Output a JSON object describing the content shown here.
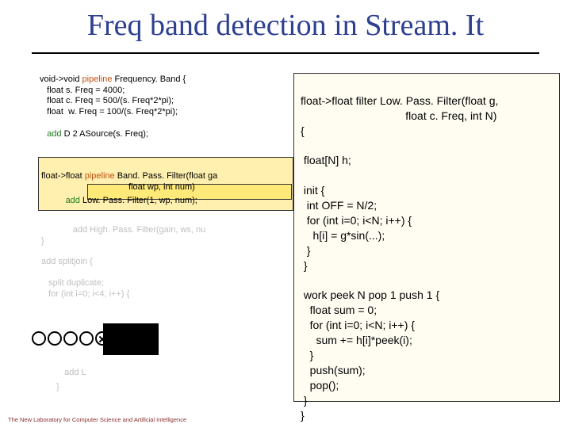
{
  "title": "Freq band detection in Stream. It",
  "footer": "The New Laboratory for Computer Science and Artificial Intelligence",
  "left": {
    "sig0": "void->void ",
    "kw_pipeline0": "pipeline",
    "sig0b": " Frequency. Band {",
    "l1": "   float s. Freq = 4000;",
    "l2": "   float c. Freq = 500/(s. Freq*2*pi);",
    "l3": "   float  w. Freq = 100/(s. Freq*2*pi);",
    "add1_pre": "   ",
    "add1_kw": "add",
    "add1_post": " D 2 ASource(s. Freq);",
    "sig1": "float->float ",
    "kw_pipeline1": "pipeline",
    "sig1b": " Band. Pass. Filter(float ga",
    "sig1c": "                                    float wp, int num)",
    "add2_pre": "          ",
    "add2_kw": "add",
    "add2_post": " Low. Pass. Filter(1, wp, num);",
    "hp_pre": "             ",
    "hp": "add High. Pass. Filter(gain, ws, nu",
    "cb1": "}",
    "sj": "add splitjoin {",
    "sj_split": "   split duplicate;",
    "sj_for": "   for (int i=0; i<4; i++) {",
    "addL": "   add L",
    "cb2": "   }",
    "circles": [
      "open",
      "open",
      "open",
      "open",
      "x",
      "x",
      "x",
      "x"
    ]
  },
  "right": {
    "sig": "float->float ",
    "filter_kw": "filter",
    "sig2": " Low. Pass. Filter(float g,\n                                  float c. Freq, int N)",
    "ob": "{",
    "arr": " float[N] h;",
    "init_kw": " init",
    "init_body": " {\n  int OFF = N/2;\n  for (int i=0; i<N; i++) {\n    h[i] = g*sin(...);\n  }\n }",
    "work_kw": " work",
    "work_sig": " peek N pop 1 push 1 {\n   float sum = 0;\n   for (int i=0; i<N; i++) {\n     sum += h[i]*peek(i);\n   }\n   push(sum);\n   pop();\n }",
    "cb": "}"
  }
}
